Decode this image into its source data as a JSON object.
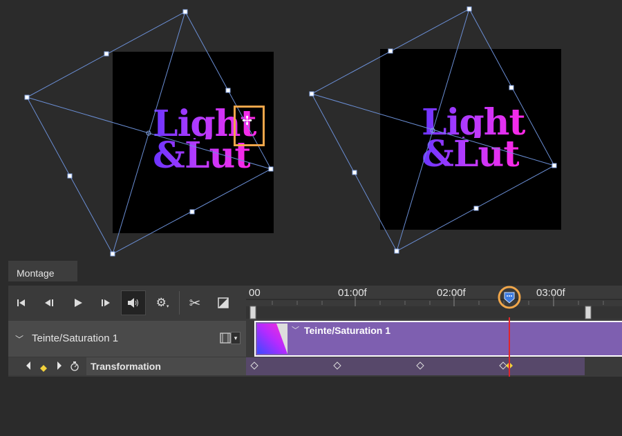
{
  "canvas": {
    "doc_left": {
      "line1": "Light",
      "line2": "&Lut"
    },
    "doc_right": {
      "line1": "Light",
      "line2": "&Lut"
    }
  },
  "panel": {
    "tab_label": "Montage",
    "controls": [
      {
        "name": "go-to-first-frame-icon",
        "glyph": "|◀"
      },
      {
        "name": "previous-frame-icon",
        "glyph": "◀|"
      },
      {
        "name": "play-icon",
        "glyph": "▶"
      },
      {
        "name": "next-frame-icon",
        "glyph": "|▶"
      },
      {
        "name": "audio-icon",
        "glyph": "🔊"
      },
      {
        "name": "settings-gear-icon",
        "glyph": "⚙"
      },
      {
        "name": "split-scissors-icon",
        "glyph": "✂"
      },
      {
        "name": "transition-icon",
        "glyph": "◪"
      }
    ],
    "ruler_labels": [
      "00",
      "01:00f",
      "02:00f",
      "03:00f"
    ],
    "layer": {
      "name": "Teinte/Saturation 1",
      "clip_title": "Teinte/Saturation 1"
    },
    "property": {
      "name": "Transformation"
    }
  },
  "colors": {
    "highlight": "#f0a64a",
    "clip": "#7e5fb0",
    "playhead": "#e0252b",
    "guide": "#6b8fd6"
  }
}
